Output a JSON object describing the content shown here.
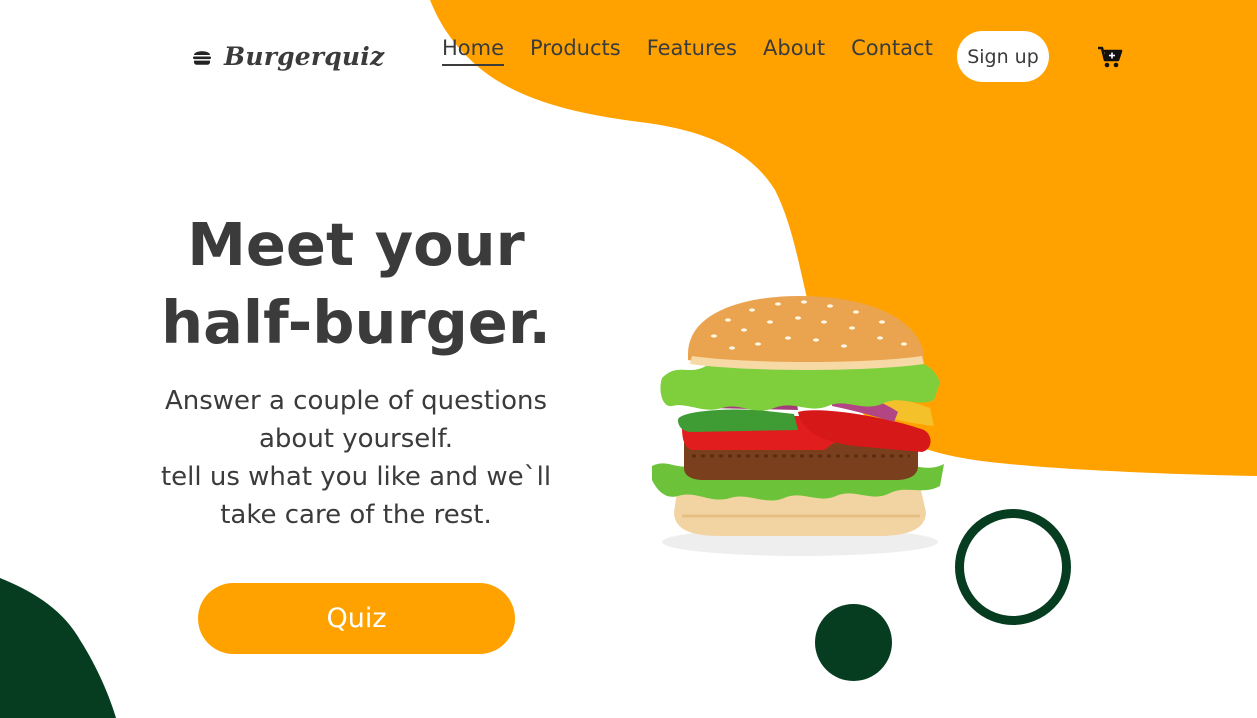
{
  "brand": {
    "name": "Burgerquiz",
    "icon": "burger-icon"
  },
  "nav": {
    "items": [
      {
        "label": "Home",
        "active": true
      },
      {
        "label": "Products",
        "active": false
      },
      {
        "label": "Features",
        "active": false
      },
      {
        "label": "About",
        "active": false
      },
      {
        "label": "Contact",
        "active": false
      }
    ],
    "signup_label": "Sign up",
    "cart_icon": "cart-icon"
  },
  "hero": {
    "title_line1": "Meet your",
    "title_line2": "half-burger.",
    "subtitle_line1": "Answer a couple of questions",
    "subtitle_line2": "about yourself.",
    "subtitle_line3": "tell us what you like and we`ll",
    "subtitle_line4": "take care of the rest.",
    "cta_label": "Quiz"
  },
  "colors": {
    "accent": "#ffa200",
    "dark_green": "#063d20",
    "text": "#3b3b3b",
    "background": "#ffffff"
  }
}
